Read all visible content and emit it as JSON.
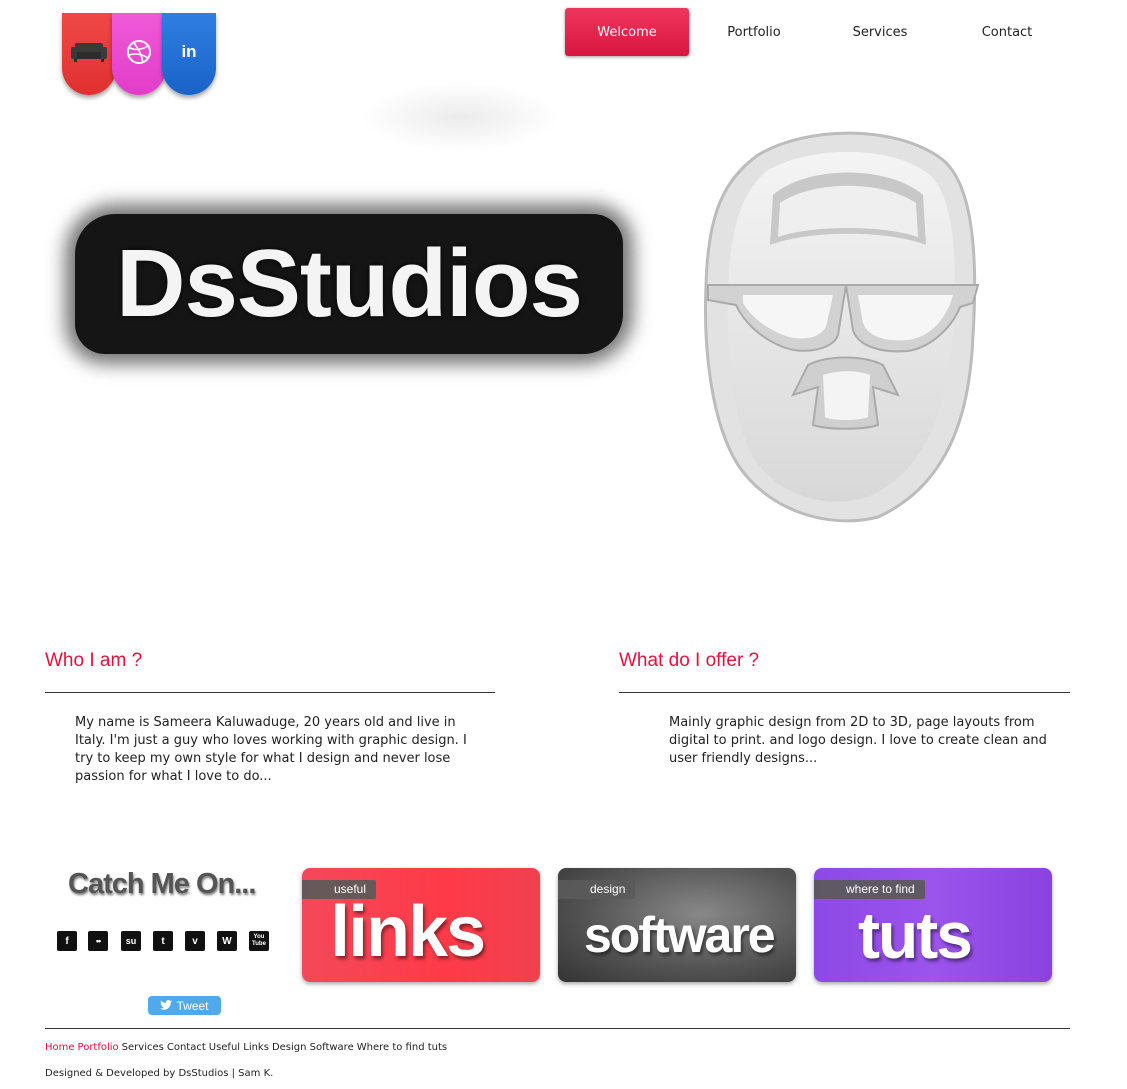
{
  "social_tabs": [
    {
      "name": "sofa",
      "icon": "sofa-icon",
      "color": "#e83a3a"
    },
    {
      "name": "dribbble",
      "icon": "dribbble-icon",
      "color": "#e646d0"
    },
    {
      "name": "linkedin",
      "icon": "linkedin-icon",
      "label": "in",
      "color": "#2470d6"
    }
  ],
  "nav": {
    "items": [
      "Welcome",
      "Portfolio",
      "Services",
      "Contact"
    ],
    "active": "Welcome",
    "accent": "#e4113f"
  },
  "hero": {
    "logo_text": "DsStudios"
  },
  "who": {
    "title": "Who I am ?",
    "body": "My name is Sameera Kaluwaduge, 20 years old and live in Italy. I'm just a guy who loves working with graphic design. I try to keep my own style for what I design and never lose passion for what I love to do..."
  },
  "offer": {
    "title": "What do I offer ?",
    "body": "Mainly graphic design from 2D to 3D, page layouts from digital to print. and logo design. I love to create clean and user friendly designs..."
  },
  "catch_me": {
    "title": "Catch Me On...",
    "icons": [
      {
        "name": "facebook-icon",
        "glyph": "f"
      },
      {
        "name": "flickr-icon",
        "glyph": "••"
      },
      {
        "name": "stumbleupon-icon",
        "glyph": "su"
      },
      {
        "name": "twitter-icon",
        "glyph": "t"
      },
      {
        "name": "vimeo-icon",
        "glyph": "v"
      },
      {
        "name": "wordpress-icon",
        "glyph": "W"
      },
      {
        "name": "youtube-icon",
        "glyph": "You Tube"
      }
    ],
    "tweet_label": "Tweet"
  },
  "cards": [
    {
      "tag": "useful",
      "big": "links"
    },
    {
      "tag": "design",
      "big": "software"
    },
    {
      "tag": "where to find",
      "big": "tuts"
    }
  ],
  "footer": {
    "links": [
      "Home",
      "Portfolio",
      "Services",
      "Contact",
      "Useful Links",
      "Design Software",
      "Where to find tuts"
    ],
    "credit": "Designed & Developed by DsStudios | Sam K."
  }
}
